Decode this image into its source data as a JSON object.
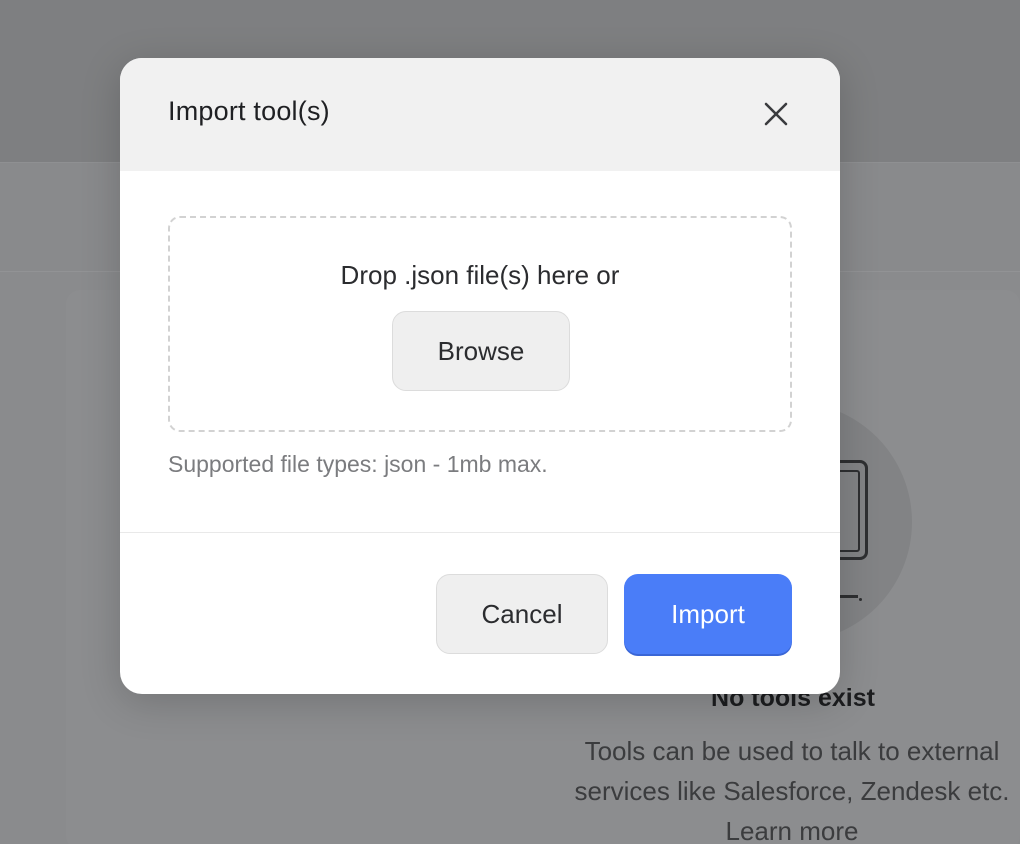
{
  "background": {
    "empty_state": {
      "title": "No tools exist",
      "description": "Tools can be used to talk to external services like Salesforce, Zendesk etc.",
      "learn_more": "Learn more"
    }
  },
  "modal": {
    "title": "Import tool(s)",
    "close_icon": "close-icon",
    "dropzone": {
      "text": "Drop .json file(s) here or",
      "browse_label": "Browse"
    },
    "hint": "Supported file types: json - 1mb max.",
    "cancel_label": "Cancel",
    "import_label": "Import"
  },
  "colors": {
    "primary": "#4a7df8",
    "overlay": "#8a8b8d"
  }
}
